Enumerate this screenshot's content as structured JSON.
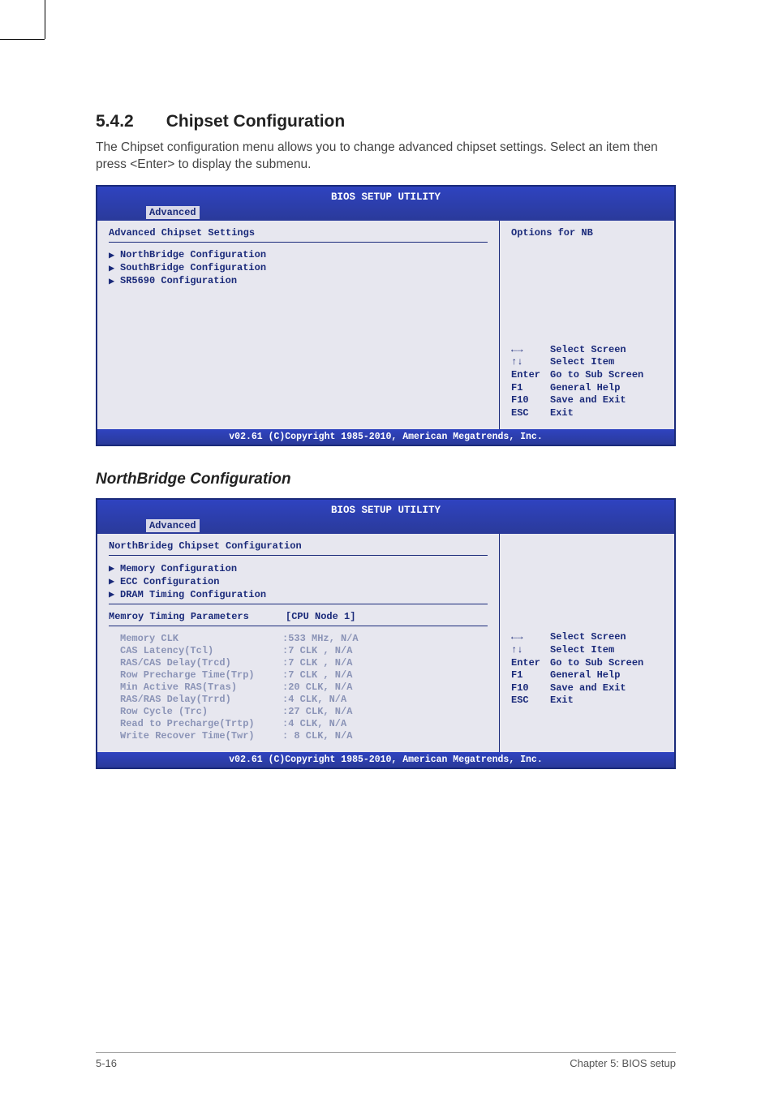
{
  "section": {
    "number": "5.4.2",
    "title": "Chipset Configuration"
  },
  "intro": "The Chipset configuration menu allows you to change advanced chipset settings. Select an item then press <Enter> to display the submenu.",
  "bios1": {
    "title": "BIOS SETUP UTILITY",
    "tab": "Advanced",
    "heading": "Advanced Chipset Settings",
    "items": [
      "NorthBridge Configuration",
      "SouthBridge Configuration",
      "SR5690 Configuration"
    ],
    "right_title": "Options for NB",
    "help": [
      {
        "key": "←→",
        "txt": "Select Screen"
      },
      {
        "key": "↑↓",
        "txt": "Select Item"
      },
      {
        "key": "Enter",
        "txt": "Go to Sub Screen"
      },
      {
        "key": "F1",
        "txt": "General Help"
      },
      {
        "key": "F10",
        "txt": "Save and Exit"
      },
      {
        "key": "ESC",
        "txt": "Exit"
      }
    ],
    "footer": "v02.61 (C)Copyright 1985-2010, American Megatrends, Inc."
  },
  "subheading": "NorthBridge Configuration",
  "bios2": {
    "title": "BIOS SETUP UTILITY",
    "tab": "Advanced",
    "heading": "NorthBrideg Chipset Configuration",
    "items": [
      "Memory Configuration",
      "ECC Configuration",
      "DRAM Timing Configuration"
    ],
    "timing_label": "Memroy Timing Parameters",
    "timing_value": "[CPU Node 1]",
    "params": [
      {
        "label": "Memory CLK",
        "val": ":533 MHz, N/A"
      },
      {
        "label": "CAS Latency(Tcl)",
        "val": ":7 CLK , N/A"
      },
      {
        "label": "RAS/CAS Delay(Trcd)",
        "val": ":7 CLK , N/A"
      },
      {
        "label": "Row Precharge Time(Trp)",
        "val": ":7 CLK , N/A"
      },
      {
        "label": "Min Active RAS(Tras)",
        "val": ":20 CLK, N/A"
      },
      {
        "label": "RAS/RAS Delay(Trrd)",
        "val": ":4 CLK, N/A"
      },
      {
        "label": "Row Cycle (Trc)",
        "val": ":27 CLK, N/A"
      },
      {
        "label": "Read to Precharge(Trtp)",
        "val": ":4 CLK, N/A"
      },
      {
        "label": "Write Recover Time(Twr)",
        "val": ": 8 CLK, N/A"
      }
    ],
    "help": [
      {
        "key": "←→",
        "txt": "Select Screen"
      },
      {
        "key": "↑↓",
        "txt": "Select Item"
      },
      {
        "key": "Enter",
        "txt": "Go to Sub Screen"
      },
      {
        "key": "F1",
        "txt": "General Help"
      },
      {
        "key": "F10",
        "txt": "Save and Exit"
      },
      {
        "key": "ESC",
        "txt": "Exit"
      }
    ],
    "footer": "v02.61 (C)Copyright 1985-2010, American Megatrends, Inc."
  },
  "footer": {
    "left": "5-16",
    "right": "Chapter 5: BIOS setup"
  }
}
